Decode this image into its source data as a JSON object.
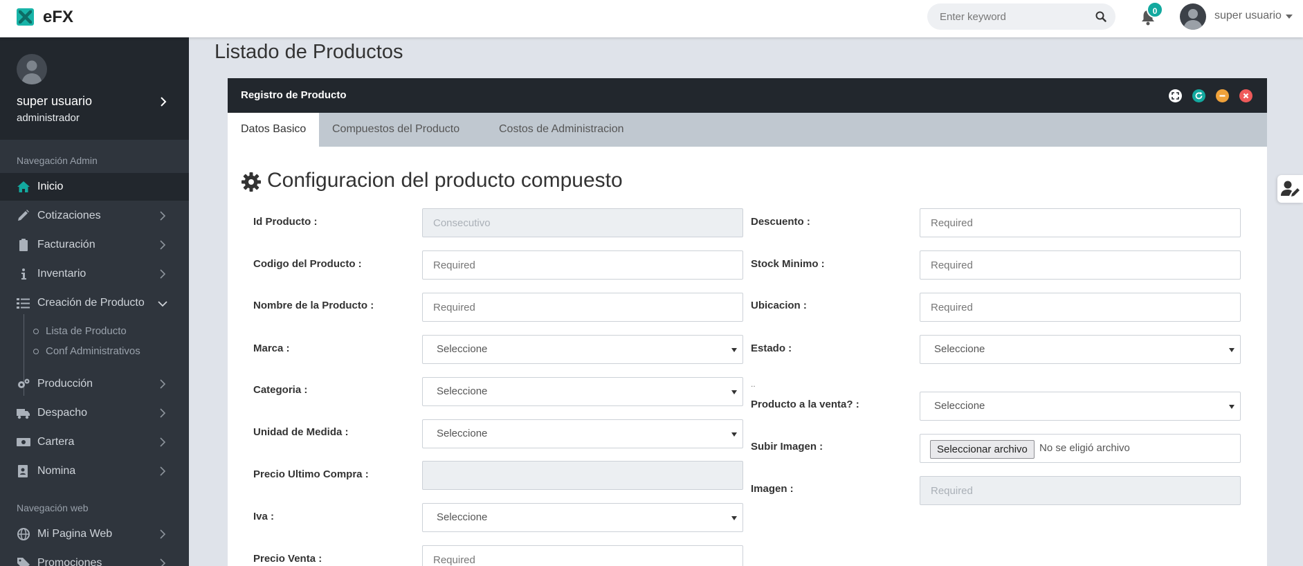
{
  "brand": {
    "name": "eFX"
  },
  "topbar": {
    "search_placeholder": "Enter keyword",
    "notifications_count": "0",
    "user_name": "super usuario"
  },
  "sidebar": {
    "profile": {
      "name": "super usuario",
      "role": "administrador"
    },
    "admin_header": "Navegación Admin",
    "items": [
      {
        "label": "Inicio",
        "icon": "home-icon",
        "active": true
      },
      {
        "label": "Cotizaciones",
        "icon": "pencil-icon"
      },
      {
        "label": "Facturación",
        "icon": "clipboard-icon"
      },
      {
        "label": "Inventario",
        "icon": "info-icon"
      },
      {
        "label": "Creación de Producto",
        "icon": "list-check-icon",
        "expanded": true
      },
      {
        "label": "Producción",
        "icon": "gears-icon"
      },
      {
        "label": "Despacho",
        "icon": "truck-icon"
      },
      {
        "label": "Cartera",
        "icon": "money-icon"
      },
      {
        "label": "Nomina",
        "icon": "address-book-icon"
      }
    ],
    "subitems": [
      "Lista de Producto",
      "Conf Administrativos"
    ],
    "web_header": "Navegación web",
    "web_items": [
      {
        "label": "Mi Pagina Web",
        "icon": "globe-icon"
      },
      {
        "label": "Promociones",
        "icon": "tag-icon"
      }
    ]
  },
  "page": {
    "title": "Listado de Productos"
  },
  "panel": {
    "title": "Registro de Producto",
    "tabs": [
      "Datos Basico",
      "Compuestos del Producto",
      "Costos de Administracion"
    ],
    "section_title": "Configuracion del producto compuesto",
    "left_fields": [
      {
        "label": "Id Producto :",
        "type": "input",
        "placeholder": "Consecutivo",
        "readonly": true
      },
      {
        "label": "Codigo del Producto :",
        "type": "input",
        "placeholder": "Required"
      },
      {
        "label": "Nombre de la Producto :",
        "type": "input",
        "placeholder": "Required"
      },
      {
        "label": "Marca :",
        "type": "select",
        "value": "Seleccione"
      },
      {
        "label": "Categoria :",
        "type": "select",
        "value": "Seleccione"
      },
      {
        "label": "Unidad de Medida :",
        "type": "select",
        "value": "Seleccione"
      },
      {
        "label": "Precio Ultimo Compra :",
        "type": "input",
        "placeholder": "",
        "readonly": true
      },
      {
        "label": "Iva :",
        "type": "select",
        "value": "Seleccione"
      },
      {
        "label": "Precio Venta :",
        "type": "input",
        "placeholder": "Required"
      }
    ],
    "right_fields": [
      {
        "label": "Descuento :",
        "type": "input",
        "placeholder": "Required"
      },
      {
        "label": "Stock Minimo :",
        "type": "input",
        "placeholder": "Required"
      },
      {
        "label": "Ubicacion :",
        "type": "input",
        "placeholder": "Required"
      },
      {
        "label": "Estado :",
        "type": "select",
        "value": "Seleccione"
      },
      {
        "label": "Producto a la venta? :",
        "type": "select",
        "value": "Seleccione"
      },
      {
        "label": "Subir Imagen :",
        "type": "file",
        "button": "Seleccionar archivo",
        "status": "No se eligió archivo"
      },
      {
        "label": "Imagen :",
        "type": "input",
        "placeholder": "Required",
        "readonly": true
      }
    ],
    "dotdot": "..",
    "window_buttons": [
      {
        "name": "expand",
        "color": "#ffffff"
      },
      {
        "name": "refresh",
        "color": "#13a99f"
      },
      {
        "name": "minimize",
        "color": "#f0a23a"
      },
      {
        "name": "close",
        "color": "#ef5a5a"
      }
    ]
  },
  "colors": {
    "accent": "#13a99f",
    "sidebar": "#2f353d",
    "sidebar_dark": "#22272d"
  }
}
